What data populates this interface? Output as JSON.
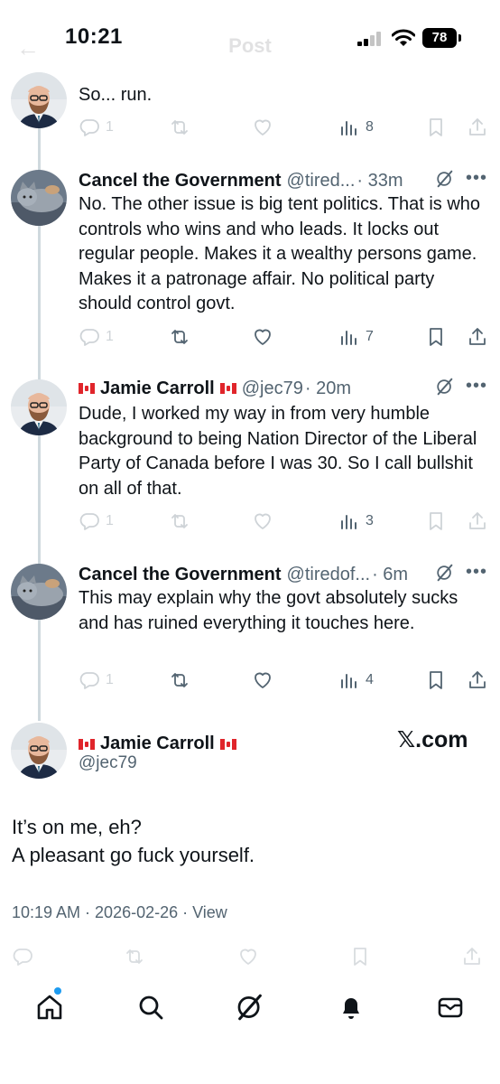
{
  "status_bar": {
    "time": "10:21",
    "battery": "78"
  },
  "header": {
    "title": "Post"
  },
  "thread": [
    {
      "name": "",
      "handle": "",
      "time": "",
      "text": "So... run.",
      "stats": {
        "replies": "1",
        "views": "8"
      }
    },
    {
      "name": "Cancel the Government",
      "handle": "@tired...",
      "time": "· 33m",
      "text": "No. The other issue is big tent politics. That is who controls who wins and who leads. It locks out regular people. Makes it a wealthy persons game. Makes it a patronage affair. No political party should control govt.",
      "stats": {
        "replies": "1",
        "views": "7"
      }
    },
    {
      "name": "Jamie Carroll",
      "handle": "@jec79",
      "time": "· 20m",
      "text": "Dude, I worked my way in from very humble background to being Nation Director of the Liberal Party of Canada before I was 30. So I call bullshit on all of that.",
      "stats": {
        "replies": "1",
        "views": "3"
      }
    },
    {
      "name": "Cancel the Government",
      "handle": "@tiredof...",
      "time": "· 6m",
      "text": "This may explain why the govt absolutely sucks and has ruined everything it touches here.",
      "stats": {
        "replies": "1",
        "views": "4"
      }
    }
  ],
  "main_post": {
    "name": "Jamie Carroll",
    "handle": "@jec79",
    "badge": "𝕏.com",
    "text_line1": "It’s on me, eh?",
    "text_line2": "A pleasant go fuck yourself.",
    "meta": "10:19 AM · 2026-02-26 · View"
  },
  "icons": {
    "reply": "reply-icon",
    "repost": "repost-icon",
    "like": "heart-icon",
    "views": "views-icon",
    "bookmark": "bookmark-icon",
    "share": "share-icon",
    "grok": "grok-icon",
    "more": "more-icon"
  },
  "bottom_nav": [
    "home-icon",
    "search-icon",
    "grok-icon",
    "notifications-icon",
    "messages-icon"
  ],
  "colors": {
    "accent": "#1d9bf0",
    "secondary_text": "#536471",
    "flag_red": "#e0252b"
  }
}
